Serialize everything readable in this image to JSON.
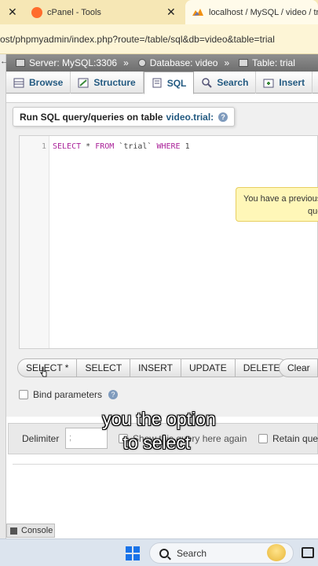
{
  "browser": {
    "tabs": [
      {
        "title": "cPanel - Tools"
      },
      {
        "title": "localhost / MySQL / video / trial"
      }
    ],
    "url": "ost/phpmyadmin/index.php?route=/table/sql&db=video&table=trial"
  },
  "breadcrumb": {
    "server": "Server: MySQL:3306",
    "database": "Database: video",
    "table": "Table: trial",
    "separator": "»"
  },
  "tabs": [
    "Browse",
    "Structure",
    "SQL",
    "Search",
    "Insert"
  ],
  "active_tab": "SQL",
  "legend": {
    "prefix": "Run SQL query/queries on table",
    "link": "video.trial:"
  },
  "editor": {
    "line_number": "1",
    "kw_select": "SELECT",
    "star": " * ",
    "kw_from": "FROM",
    "table": " `trial` ",
    "kw_where": "WHERE",
    "value": " 1"
  },
  "tooltip": {
    "line1": "You have a previous",
    "line2": "que"
  },
  "query_buttons": [
    "SELECT *",
    "SELECT",
    "INSERT",
    "UPDATE",
    "DELETE"
  ],
  "clear_label": "Clear",
  "bind_parameters": "Bind parameters",
  "delimiter": {
    "label": "Delimiter",
    "value": ";"
  },
  "show_query": "Show this query here again",
  "retain_query": "Retain query",
  "console_label": "Console",
  "caption": {
    "line1": "you the option",
    "line2": "to select"
  },
  "taskbar": {
    "search_label": "Search"
  }
}
